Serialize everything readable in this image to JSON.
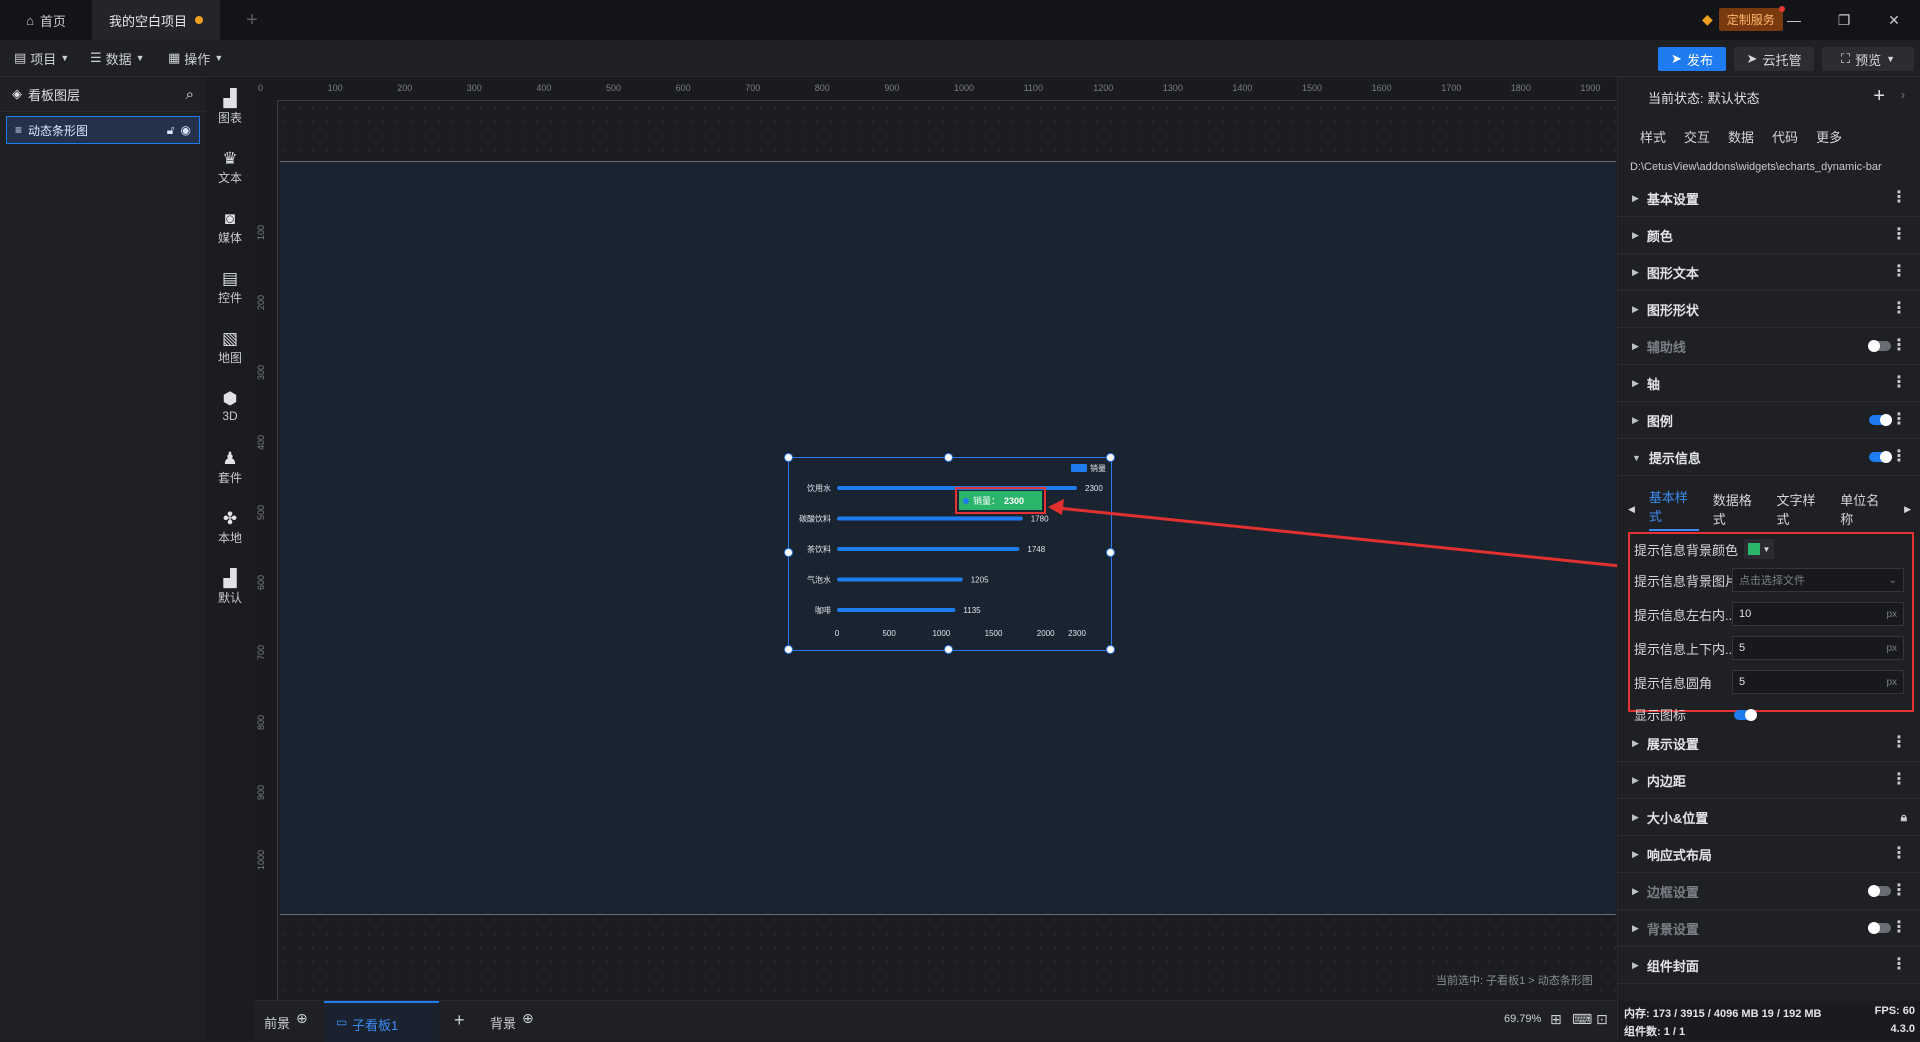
{
  "titlebar": {
    "home_tab": "首页",
    "project_tab": "我的空白项目",
    "custom_service": "定制服务"
  },
  "toolbar": {
    "menus": [
      "项目",
      "数据",
      "操作"
    ],
    "publish": "发布",
    "cloud": "云托管",
    "preview": "预览"
  },
  "layers": {
    "title": "看板图层",
    "item": "动态条形图"
  },
  "components": [
    "图表",
    "文本",
    "媒体",
    "控件",
    "地图",
    "3D",
    "套件",
    "本地",
    "默认"
  ],
  "ruler": {
    "top": [
      "0",
      "100",
      "200",
      "300",
      "400",
      "500",
      "600",
      "700",
      "800",
      "900",
      "1000",
      "1100",
      "1200",
      "1300",
      "1400",
      "1500",
      "1600",
      "1700",
      "1800",
      "1900"
    ],
    "left": [
      "100",
      "200",
      "300",
      "400",
      "500",
      "600",
      "700",
      "800",
      "900",
      "1000"
    ]
  },
  "canvas": {
    "selection_path": "当前选中: 子看板1 > 动态条形图"
  },
  "chart_data": {
    "type": "bar",
    "orientation": "horizontal",
    "categories": [
      "饮用水",
      "碳酸饮料",
      "茶饮料",
      "气泡水",
      "咖啡"
    ],
    "series": [
      {
        "name": "销量",
        "values": [
          2300,
          1780,
          1748,
          1205,
          1135
        ],
        "color": "#1e7cf0"
      }
    ],
    "xticks": [
      "0",
      "500",
      "1000",
      "1500",
      "2000",
      "2300"
    ],
    "xlim": [
      0,
      2300
    ],
    "legend": "top-right",
    "tooltip": {
      "label": "销量：",
      "value": "2300",
      "background": "#2ab56b"
    }
  },
  "bottombar": {
    "foreground": "前景",
    "board": "子看板1",
    "background": "背景",
    "zoom": "69.79%"
  },
  "panel": {
    "state_label": "当前状态:",
    "state_value": "默认状态",
    "tabs": [
      "样式",
      "交互",
      "数据",
      "代码",
      "更多"
    ],
    "path": "D:\\CetusView\\addons\\widgets\\echarts_dynamic-bar",
    "sections_top": [
      {
        "label": "基本设置",
        "enabled": true
      },
      {
        "label": "颜色",
        "enabled": true
      },
      {
        "label": "图形文本",
        "enabled": true
      },
      {
        "label": "图形形状",
        "enabled": true
      },
      {
        "label": "辅助线",
        "enabled": false
      },
      {
        "label": "轴",
        "enabled": true
      },
      {
        "label": "图例",
        "enabled": true
      },
      {
        "label": "提示信息",
        "enabled": true
      }
    ],
    "subtabs": [
      "基本样式",
      "数据格式",
      "文字样式",
      "单位名称"
    ],
    "fields": {
      "bg_color_label": "提示信息背景颜色",
      "bg_color": "#2ab56b",
      "bg_image_label": "提示信息背景图片",
      "bg_image_placeholder": "点击选择文件",
      "pad_lr_label": "提示信息左右内...",
      "pad_lr": "10",
      "pad_tb_label": "提示信息上下内...",
      "pad_tb": "5",
      "radius_label": "提示信息圆角",
      "radius": "5",
      "show_icon_label": "显示图标",
      "unit": "px"
    },
    "sections_bottom": [
      {
        "label": "展示设置",
        "enabled": true
      },
      {
        "label": "内边距",
        "enabled": true
      },
      {
        "label": "大小&位置",
        "enabled": true
      },
      {
        "label": "响应式布局",
        "enabled": true
      },
      {
        "label": "边框设置",
        "enabled": false
      },
      {
        "label": "背景设置",
        "enabled": false
      },
      {
        "label": "组件封面",
        "enabled": true
      }
    ],
    "status": {
      "memory": "内存: 173 / 3915 / 4096 MB 19 / 192 MB",
      "fps": "FPS: 60",
      "count": "组件数: 1 / 1",
      "version": "4.3.0"
    }
  }
}
